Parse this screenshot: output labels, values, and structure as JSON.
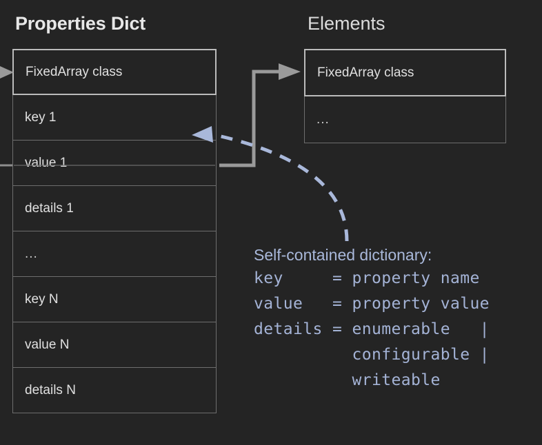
{
  "diagram": {
    "background_color": "#242424",
    "text_color": "#e0e0e0",
    "border_color": "#6e6e6e",
    "head_border_color": "#bcbcbc",
    "accent_color": "#a4b3d6",
    "connector_color": "#9a9a9a"
  },
  "properties_dict": {
    "title": "Properties Dict",
    "rows": [
      {
        "label": "FixedArray class",
        "kind": "head"
      },
      {
        "label": "key 1",
        "kind": "row"
      },
      {
        "label": "value 1",
        "kind": "row"
      },
      {
        "label": "details 1",
        "kind": "row"
      },
      {
        "label": "...",
        "kind": "ellipsis"
      },
      {
        "label": "key N",
        "kind": "row"
      },
      {
        "label": "value N",
        "kind": "row"
      },
      {
        "label": "details N",
        "kind": "row"
      }
    ]
  },
  "elements": {
    "title": "Elements",
    "rows": [
      {
        "label": "FixedArray class",
        "kind": "head"
      },
      {
        "label": "...",
        "kind": "ellipsis"
      }
    ]
  },
  "annotation": {
    "title": "Self-contained dictionary:",
    "lines": [
      "key     = property name",
      "value   = property value",
      "details = enumerable   |",
      "          configurable |",
      "          writeable"
    ]
  },
  "connectors": {
    "incoming_class_pointer": "arrow-into-fixedarray-class",
    "incoming_value_pointer": "line-into-value-1",
    "elements_pointer": "elbow-arrow-value1-to-elements",
    "annotation_pointer": "dashed-curve-note-to-key1"
  }
}
